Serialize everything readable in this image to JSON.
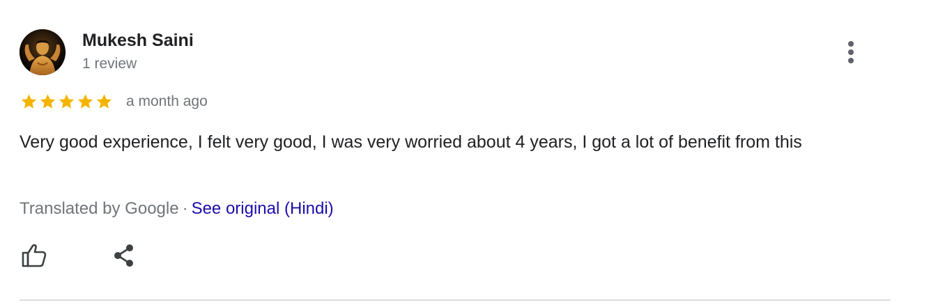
{
  "review": {
    "author": {
      "name": "Mukesh Saini",
      "meta": "1 review",
      "avatar_icon": "user-avatar-photo"
    },
    "rating": {
      "stars": 5,
      "max_stars": 5,
      "star_color": "#f4b400",
      "time_ago": "a month ago"
    },
    "text": "Very good experience, I felt very good, I was very worried about 4 years, I got a lot of benefit from this",
    "translation": {
      "translated_by": "Translated by Google",
      "separator": "·",
      "see_original": "See original (Hindi)"
    },
    "actions": {
      "like_icon": "thumbs-up-icon",
      "share_icon": "share-icon",
      "more_icon": "more-vert-icon"
    }
  },
  "colors": {
    "text_primary": "#202124",
    "text_secondary": "#70757a",
    "link": "#1a0dab",
    "divider": "#dadce0"
  }
}
